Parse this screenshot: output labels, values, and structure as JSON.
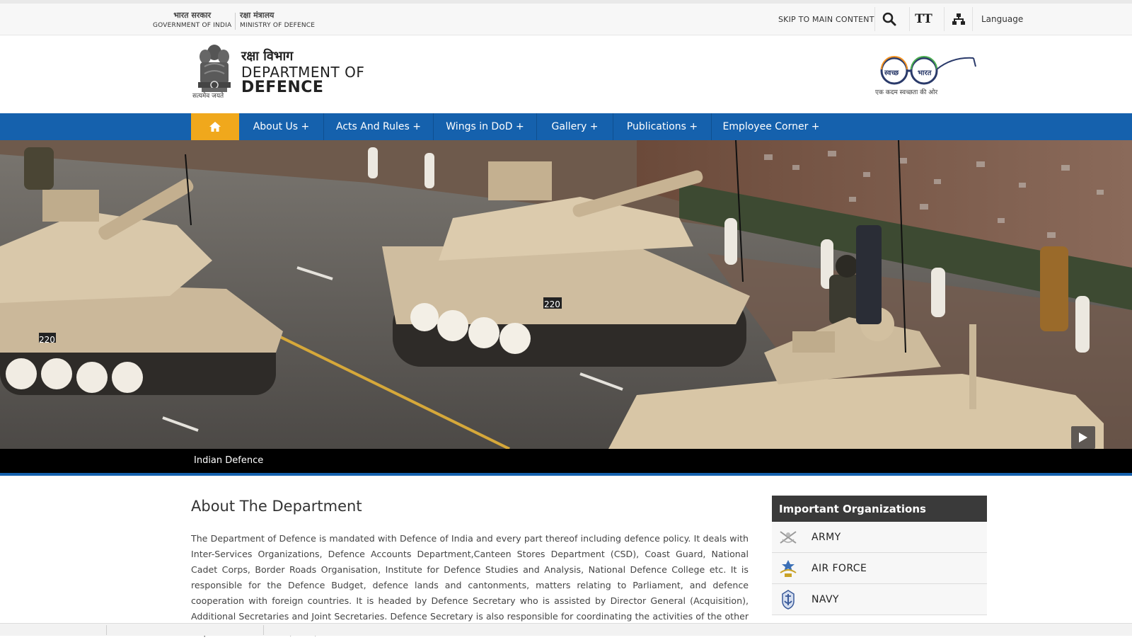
{
  "topbar": {
    "gov_india_hi": "भारत सरकार",
    "gov_india_en": "GOVERNMENT OF INDIA",
    "mod_hi": "रक्षा मंत्रालय",
    "mod_en": "MINISTRY OF DEFENCE",
    "skip_label": "SKIP TO MAIN CONTENT",
    "text_size_label": "TT",
    "language_label": "Language",
    "icons": [
      "search-icon",
      "text-size-icon",
      "sitemap-icon"
    ]
  },
  "header": {
    "emblem_caption": "सत्यमेव जयते",
    "dept_hi": "रक्षा विभाग",
    "dept_en_line1": "DEPARTMENT OF",
    "dept_en_line2": "DEFENCE",
    "swachh_word1": "स्वच्छ",
    "swachh_word2": "भारत",
    "swachh_caption": "एक कदम स्वच्छता की ओर"
  },
  "nav": {
    "home_icon": "home-icon",
    "items": [
      {
        "label": "About Us +"
      },
      {
        "label": "Acts And Rules +"
      },
      {
        "label": "Wings in DoD +"
      },
      {
        "label": "Gallery +"
      },
      {
        "label": "Publications +"
      },
      {
        "label": "Employee Corner +"
      }
    ]
  },
  "hero": {
    "caption": "Indian Defence",
    "tank_numbers": [
      "220",
      "220"
    ]
  },
  "about": {
    "title": "About The Department",
    "body": "The Department of Defence is mandated with Defence of India and every part thereof including defence policy. It deals with Inter-Services Organizations, Defence Accounts Department,Canteen Stores Department (CSD), Coast Guard, National Cadet Corps, Border Roads Organisation, Institute for Defence Studies and Analysis, National Defence College etc. It is responsible for the Defence Budget, defence lands and cantonments, matters relating to Parliament, and defence cooperation with foreign countries. It is headed by Defence Secretary who is assisted by Director General (Acquisition), Additional Secretaries and Joint Secretaries. Defence Secretary is also responsible for coordinating the activities of the other Departments i.e. DMA, DDP,"
  },
  "orgs": {
    "heading": "Important Organizations",
    "items": [
      {
        "label": "ARMY",
        "icon": "army-crest-icon"
      },
      {
        "label": "AIR FORCE",
        "icon": "air-force-crest-icon"
      },
      {
        "label": "NAVY",
        "icon": "navy-crest-icon"
      }
    ]
  },
  "colors": {
    "nav_blue": "#1561ad",
    "home_orange": "#f0a81c",
    "org_header": "#3a3a3a"
  }
}
